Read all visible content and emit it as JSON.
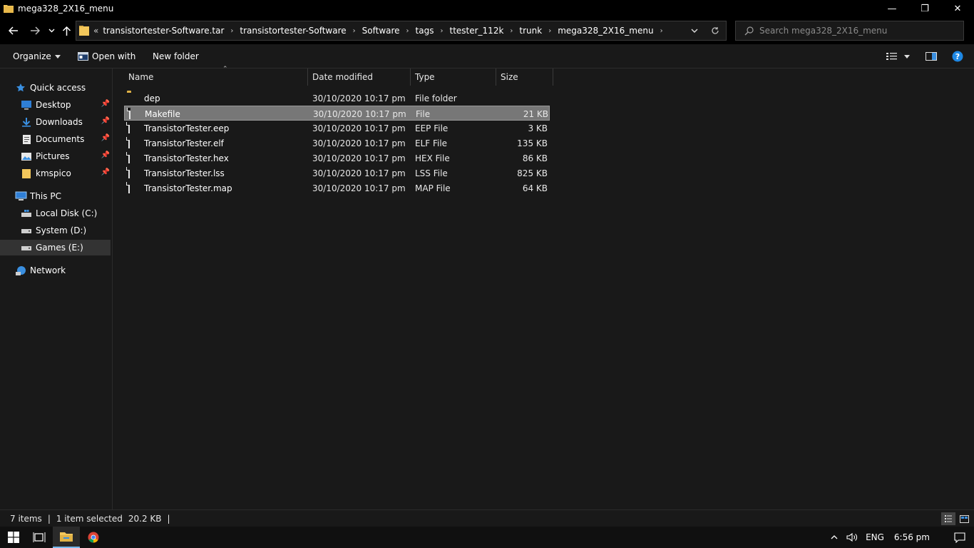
{
  "window": {
    "title": "mega328_2X16_menu",
    "minimize_glyph": "—",
    "maximize_glyph": "❐",
    "close_glyph": "✕"
  },
  "address": {
    "overflow": "«",
    "crumbs": [
      "transistortester-Software.tar",
      "transistortester-Software",
      "Software",
      "tags",
      "ttester_112k",
      "trunk",
      "mega328_2X16_menu"
    ]
  },
  "search": {
    "placeholder": "Search mega328_2X16_menu"
  },
  "commands": {
    "organize": "Organize",
    "open_with": "Open with",
    "new_folder": "New folder"
  },
  "nav": {
    "quick_access": "Quick access",
    "pinned": [
      "Desktop",
      "Downloads",
      "Documents",
      "Pictures",
      "kmspico"
    ],
    "this_pc": "This PC",
    "drives": [
      "Local Disk (C:)",
      "System (D:)",
      "Games (E:)"
    ],
    "network": "Network"
  },
  "columns": {
    "name": "Name",
    "date": "Date modified",
    "type": "Type",
    "size": "Size"
  },
  "files": [
    {
      "name": "dep",
      "date": "30/10/2020 10:17 pm",
      "type": "File folder",
      "size": "",
      "kind": "folder"
    },
    {
      "name": "Makefile",
      "date": "30/10/2020 10:17 pm",
      "type": "File",
      "size": "21 KB",
      "kind": "file"
    },
    {
      "name": "TransistorTester.eep",
      "date": "30/10/2020 10:17 pm",
      "type": "EEP File",
      "size": "3 KB",
      "kind": "file"
    },
    {
      "name": "TransistorTester.elf",
      "date": "30/10/2020 10:17 pm",
      "type": "ELF File",
      "size": "135 KB",
      "kind": "file"
    },
    {
      "name": "TransistorTester.hex",
      "date": "30/10/2020 10:17 pm",
      "type": "HEX File",
      "size": "86 KB",
      "kind": "file"
    },
    {
      "name": "TransistorTester.lss",
      "date": "30/10/2020 10:17 pm",
      "type": "LSS File",
      "size": "825 KB",
      "kind": "file"
    },
    {
      "name": "TransistorTester.map",
      "date": "30/10/2020 10:17 pm",
      "type": "MAP File",
      "size": "64 KB",
      "kind": "file"
    }
  ],
  "status": {
    "items": "7 items",
    "selected": "1 item selected",
    "selected_size": "20.2 KB"
  },
  "tray": {
    "lang": "ENG",
    "time": "6:56 pm"
  },
  "colors": {
    "folder": "#f3c75b",
    "accent": "#0078d7",
    "selection": "#777777"
  }
}
